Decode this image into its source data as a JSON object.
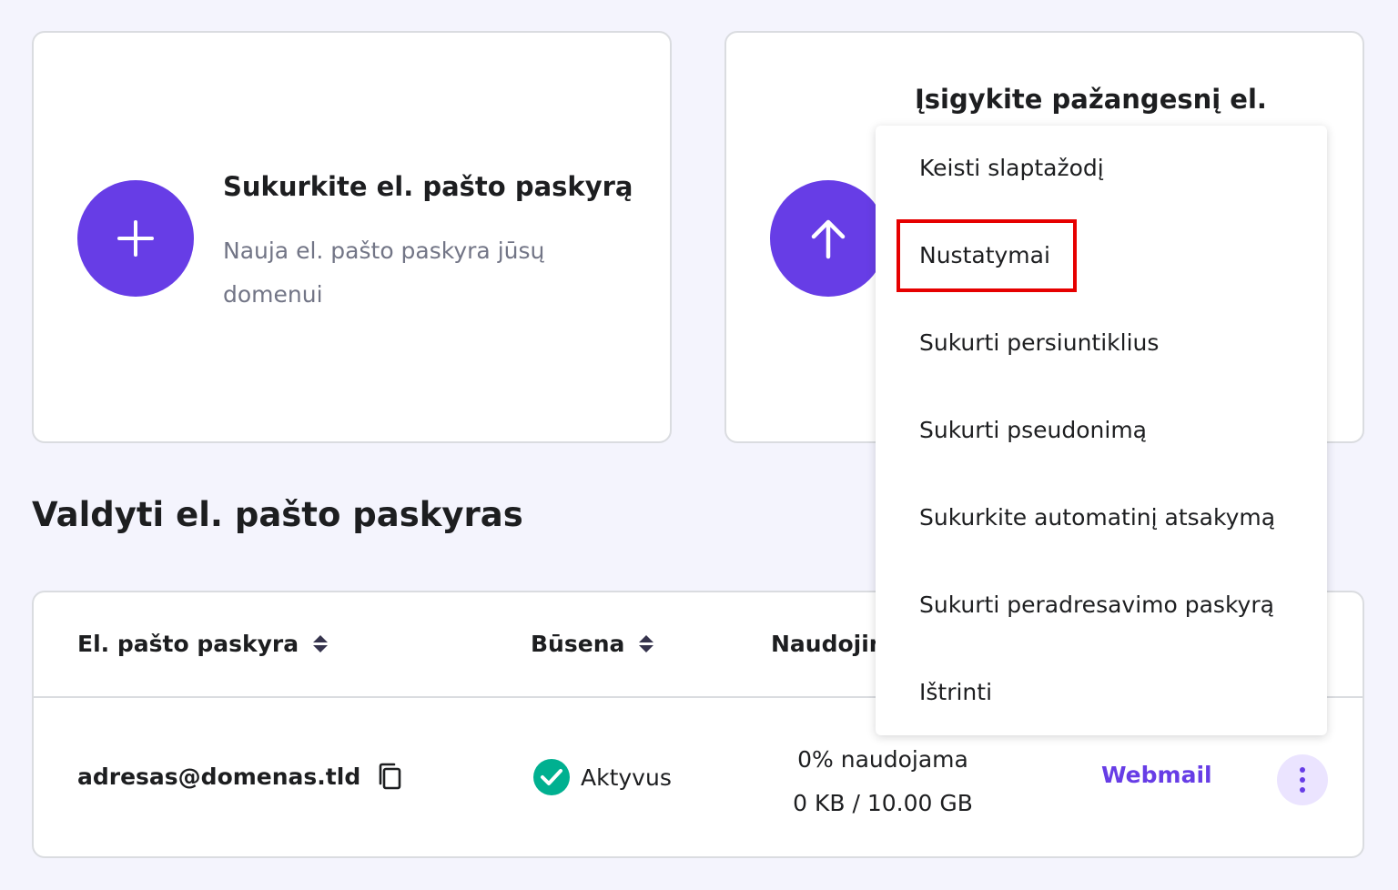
{
  "create_card": {
    "title": "Sukurkite el. pašto paskyrą",
    "description": "Nauja el. pašto paskyra jūsų domenui"
  },
  "upgrade_card": {
    "title": "Įsigykite pažangesnį el."
  },
  "section": {
    "title": "Valdyti el. pašto paskyras"
  },
  "table": {
    "headers": {
      "email": "El. pašto paskyra",
      "status": "Būsena",
      "usage": "Naudojin"
    },
    "row": {
      "email": "adresas@domenas.tld",
      "status": "Aktyvus",
      "usage_percent": "0% naudojama",
      "usage_amount": "0 KB / 10.00 GB",
      "webmail": "Webmail"
    }
  },
  "dropdown": {
    "items": [
      "Keisti slaptažodį",
      "Nustatymai",
      "Sukurti persiuntiklius",
      "Sukurti pseudonimą",
      "Sukurkite automatinį atsakymą",
      "Sukurti peradresavimo paskyrą",
      "Ištrinti"
    ],
    "highlighted_index": 1
  },
  "colors": {
    "accent": "#673de6",
    "success": "#00b090",
    "highlight": "#e60000",
    "background": "#f4f4fd"
  },
  "icons": {
    "create": "plus-icon",
    "upgrade": "arrow-up-icon",
    "copy": "copy-icon",
    "status": "check-circle-icon",
    "sort": "sort-icon",
    "more": "kebab-menu-icon"
  }
}
